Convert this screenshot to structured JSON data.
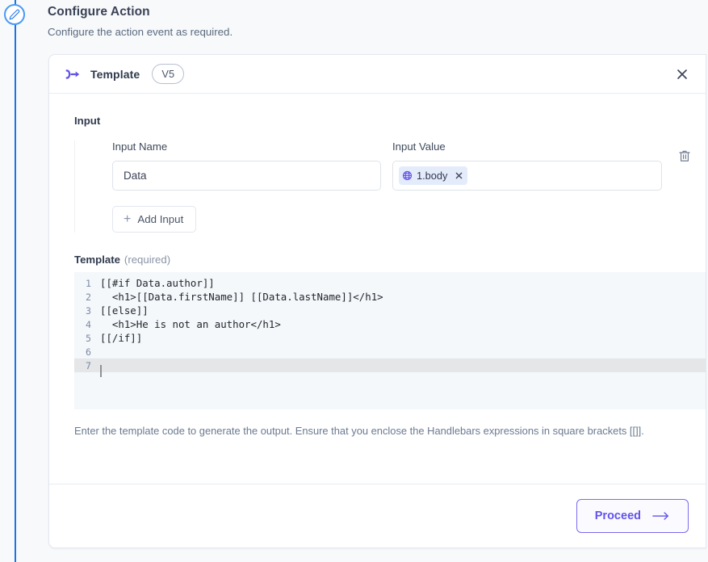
{
  "page": {
    "title": "Configure Action",
    "subtitle": "Configure the action event as required."
  },
  "step_rail": {
    "icon": "pencil-edit-icon",
    "accent_color": "#1a73e8"
  },
  "card": {
    "icon": "template-arrow-icon",
    "title": "Template",
    "version_badge": "V5",
    "close_icon": "close-icon"
  },
  "input_section": {
    "heading": "Input",
    "name_label": "Input Name",
    "value_label": "Input Value",
    "name_value": "Data",
    "name_placeholder": "Input Name",
    "chip": {
      "icon": "globe-icon",
      "label": "1.body",
      "remove_icon": "close-icon"
    },
    "delete_icon": "trash-icon",
    "add_input_label": "Add Input",
    "add_input_icon": "plus-icon"
  },
  "template_section": {
    "label": "Template",
    "required_hint": "(required)",
    "help_text": "Enter the template code to generate the output. Ensure that you enclose the Handlebars expressions in square brackets [[]].",
    "code_lines": [
      {
        "n": "1",
        "text": "[[#if Data.author]]",
        "active": false
      },
      {
        "n": "2",
        "text": "  <h1>[[Data.firstName]] [[Data.lastName]]</h1>",
        "active": false
      },
      {
        "n": "3",
        "text": "[[else]]",
        "active": false
      },
      {
        "n": "4",
        "text": "  <h1>He is not an author</h1>",
        "active": false
      },
      {
        "n": "5",
        "text": "[[/if]]",
        "active": false
      },
      {
        "n": "6",
        "text": "",
        "active": false
      },
      {
        "n": "7",
        "text": "",
        "active": true
      }
    ]
  },
  "footer": {
    "proceed_label": "Proceed",
    "proceed_icon": "arrow-right-icon"
  },
  "colors": {
    "accent_purple": "#6153e8",
    "rail_blue": "#1a73e8",
    "page_bg": "#f7f9fb",
    "chip_bg": "#e4ecfb"
  }
}
